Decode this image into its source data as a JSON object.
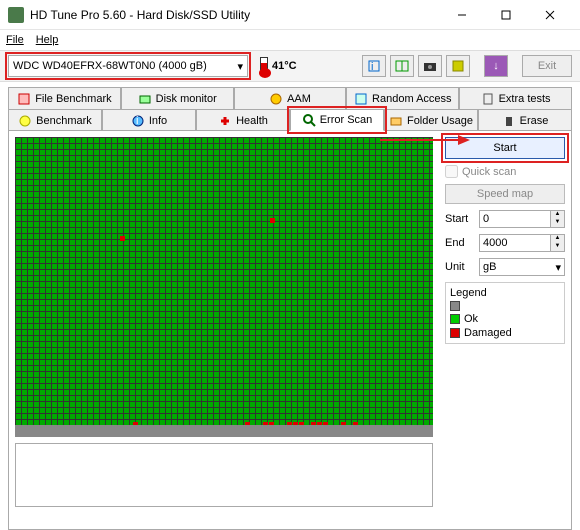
{
  "window": {
    "title": "HD Tune Pro 5.60 - Hard Disk/SSD Utility"
  },
  "menu": {
    "file": "File",
    "help": "Help"
  },
  "toolbar": {
    "drive": "WDC WD40EFRX-68WT0N0 (4000 gB)",
    "temperature": "41°C",
    "exit": "Exit"
  },
  "tabs": {
    "row1": {
      "file_benchmark": "File Benchmark",
      "disk_monitor": "Disk monitor",
      "aam": "AAM",
      "random_access": "Random Access",
      "extra_tests": "Extra tests"
    },
    "row2": {
      "benchmark": "Benchmark",
      "info": "Info",
      "health": "Health",
      "error_scan": "Error Scan",
      "folder_usage": "Folder Usage",
      "erase": "Erase"
    }
  },
  "side": {
    "start": "Start",
    "quick_scan": "Quick scan",
    "speed_map": "Speed map",
    "start_label": "Start",
    "start_val": "0",
    "end_label": "End",
    "end_val": "4000",
    "unit_label": "Unit",
    "unit_val": "gB",
    "legend_title": "Legend",
    "ok": "Ok",
    "damaged": "Damaged"
  }
}
